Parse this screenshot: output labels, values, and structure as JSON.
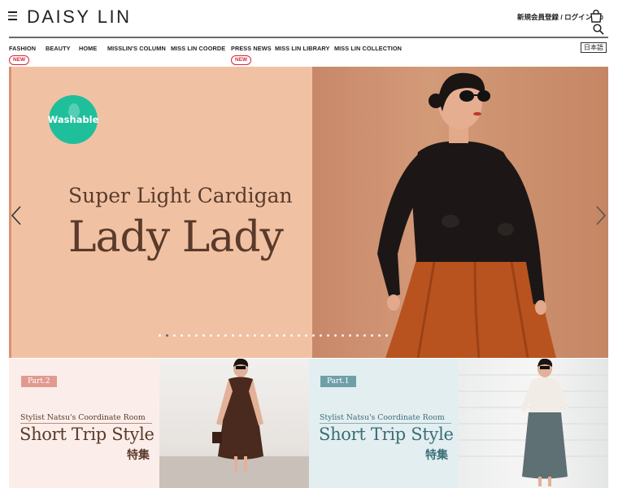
{
  "header": {
    "logo": "DAISY LIN",
    "account_link": "新規会員登録 / ログイン",
    "cart_count": "0",
    "language": "日本語"
  },
  "nav": {
    "items": [
      {
        "label": "FASHION",
        "badge": "NEW"
      },
      {
        "label": "BEAUTY"
      },
      {
        "label": "HOME"
      },
      {
        "label": "MISSLIN'S COLUMN"
      },
      {
        "label": "MISS LIN COORDE"
      },
      {
        "label": "PRESS NEWS",
        "badge": "NEW"
      },
      {
        "label": "MISS LIN LIBRARY"
      },
      {
        "label": "MISS LIN COLLECTION"
      }
    ]
  },
  "hero": {
    "badge": "Washable",
    "subtitle": "Super Light Cardigan",
    "title": "Lady Lady",
    "slide_count": 32,
    "active_slide": 2,
    "colors": {
      "left_bg": "#f0c2a3",
      "badge": "#1fbf9b",
      "text": "#5a3a2a"
    }
  },
  "tiles": [
    {
      "part": "Part.2",
      "subtitle": "Stylist Natsu's Coordinate Room",
      "title": "Short Trip Style",
      "jp": "特集",
      "colors": {
        "bg": "#fbeeea",
        "accent": "#e09a90",
        "text": "#5a3a2a"
      }
    },
    {
      "part": "Part.1",
      "subtitle": "Stylist Natsu's Coordinate Room",
      "title": "Short Trip Style",
      "jp": "特集",
      "colors": {
        "bg": "#e3eef0",
        "accent": "#6fa0a8",
        "text": "#3a6e78"
      }
    }
  ]
}
